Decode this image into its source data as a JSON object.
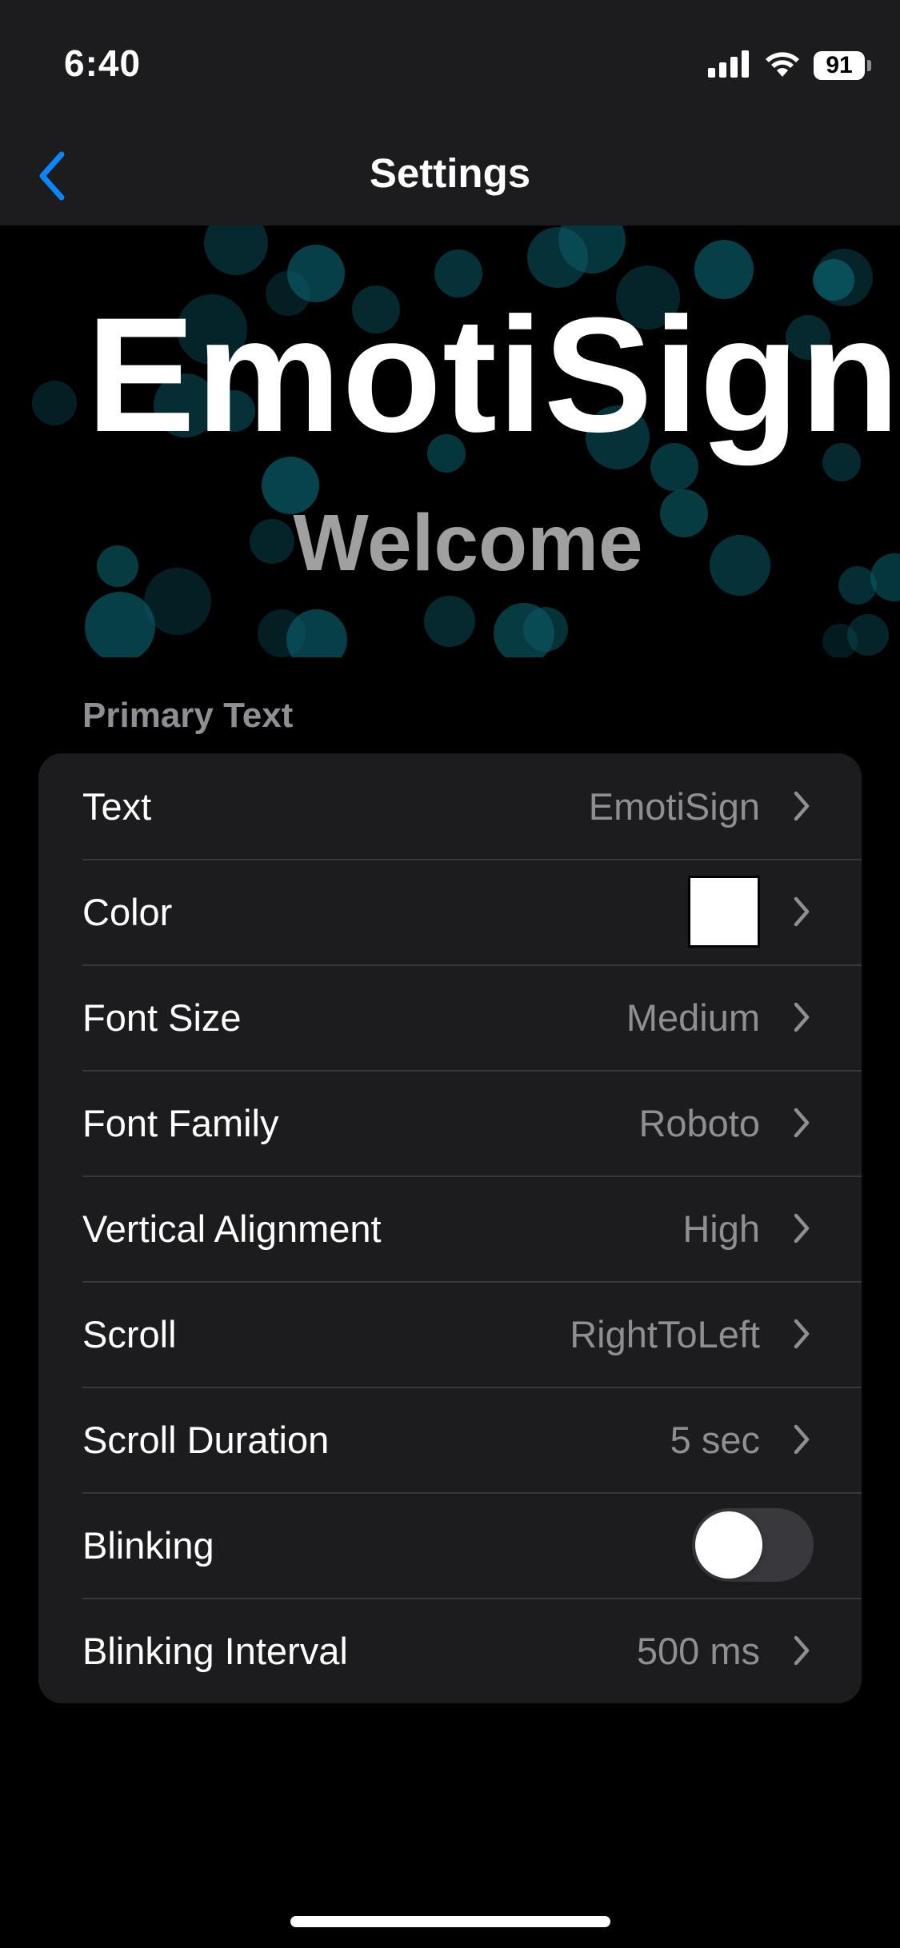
{
  "status_bar": {
    "time": "6:40",
    "battery": "91",
    "icons": [
      "signal-icon",
      "wifi-icon",
      "battery-icon"
    ]
  },
  "nav": {
    "title": "Settings",
    "back_icon": "chevron-left-icon"
  },
  "preview": {
    "primary_text": "EmotiSign",
    "secondary_text": "Welcome",
    "primary_color": "#ffffff",
    "secondary_color": "#a0a0a0",
    "bokeh_color": "#0a5a66"
  },
  "section": {
    "header": "Primary Text",
    "rows": [
      {
        "label": "Text",
        "value": "EmotiSign",
        "kind": "value"
      },
      {
        "label": "Color",
        "value": "#ffffff",
        "kind": "color"
      },
      {
        "label": "Font Size",
        "value": "Medium",
        "kind": "value"
      },
      {
        "label": "Font Family",
        "value": "Roboto",
        "kind": "value"
      },
      {
        "label": "Vertical Alignment",
        "value": "High",
        "kind": "value"
      },
      {
        "label": "Scroll",
        "value": "RightToLeft",
        "kind": "value"
      },
      {
        "label": "Scroll Duration",
        "value": "5 sec",
        "kind": "value"
      },
      {
        "label": "Blinking",
        "value": false,
        "kind": "toggle"
      },
      {
        "label": "Blinking Interval",
        "value": "500 ms",
        "kind": "value"
      }
    ]
  },
  "colors": {
    "accent": "#0a84ff",
    "background": "#000000",
    "group_background": "#1c1c1e",
    "secondary_label": "#8e8e93"
  }
}
